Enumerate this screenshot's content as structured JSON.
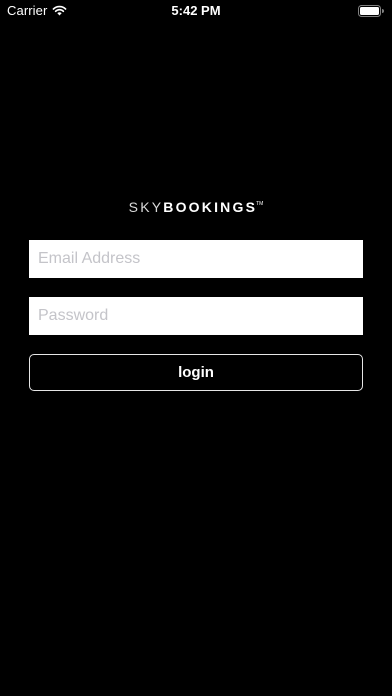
{
  "status_bar": {
    "carrier": "Carrier",
    "time": "5:42 PM",
    "wifi_icon": "wifi-icon",
    "battery_icon": "battery-icon"
  },
  "logo": {
    "sky": "SKY",
    "bookings": "BOOKINGS",
    "trademark": "TM"
  },
  "form": {
    "email_placeholder": "Email Address",
    "email_value": "",
    "password_placeholder": "Password",
    "password_value": "",
    "login_label": "login"
  },
  "colors": {
    "background": "#000000",
    "field_background": "#ffffff",
    "placeholder": "#c4c4c9",
    "button_border": "#e6e6e6",
    "text": "#ffffff"
  }
}
